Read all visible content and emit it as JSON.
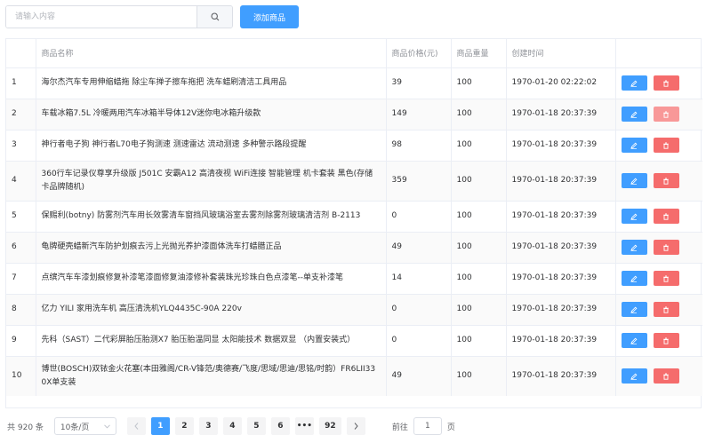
{
  "search": {
    "placeholder": "请输入内容",
    "value": ""
  },
  "toolbar": {
    "add_label": "添加商品"
  },
  "table": {
    "headers": [
      "",
      "商品名称",
      "商品价格(元)",
      "商品重量",
      "创建时间",
      ""
    ],
    "rows": [
      {
        "index": "1",
        "name": "海尔杰汽车专用伸缩蜡拖 除尘车掸子擦车拖把 洗车蜡刷清洁工具用品",
        "price": "39",
        "weight": "100",
        "created": "1970-01-20 02:22:02"
      },
      {
        "index": "2",
        "name": "车载冰箱7.5L 冷暖两用汽车冰箱半导体12V迷你电冰箱升级款",
        "price": "149",
        "weight": "100",
        "created": "1970-01-18 20:37:39"
      },
      {
        "index": "3",
        "name": "神行者电子狗 神行者L70电子狗测速 测速雷达 流动测速 多种警示路段提醒",
        "price": "98",
        "weight": "100",
        "created": "1970-01-18 20:37:39"
      },
      {
        "index": "4",
        "name": "360行车记录仪尊享升级版 J501C 安霸A12 高清夜视 WiFi连接 智能管理 机卡套装 黑色(存储卡品牌随机)",
        "price": "359",
        "weight": "100",
        "created": "1970-01-18 20:37:39"
      },
      {
        "index": "5",
        "name": "保赐利(botny) 防雾剂汽车用长效雾清车窗挡风玻璃浴室去雾剂除雾剂玻璃清洁剂 B-2113",
        "price": "0",
        "weight": "100",
        "created": "1970-01-18 20:37:39"
      },
      {
        "index": "6",
        "name": "龟牌硬壳蜡新汽车防护划痕去污上光抛光养护漆面体洗车打蜡腊正品",
        "price": "49",
        "weight": "100",
        "created": "1970-01-18 20:37:39"
      },
      {
        "index": "7",
        "name": "点缤汽车车漆划痕修复补漆笔漆面修复油漆修补套装珠光珍珠白色点漆笔--单支补漆笔",
        "price": "14",
        "weight": "100",
        "created": "1970-01-18 20:37:39"
      },
      {
        "index": "8",
        "name": "亿力 YILI 家用洗车机 高压清洗机YLQ4435C-90A 220v",
        "price": "0",
        "weight": "100",
        "created": "1970-01-18 20:37:39"
      },
      {
        "index": "9",
        "name": "先科（SAST）二代彩屏胎压胎测X7 胎压胎温同显 太阳能技术 数据双显 （内置安装式）",
        "price": "0",
        "weight": "100",
        "created": "1970-01-18 20:37:39"
      },
      {
        "index": "10",
        "name": "博世(BOSCH)双铱金火花塞(本田雅阁/CR-V锋范/奥德赛/飞度/思域/思迪/思铭/时韵）FR6LII330X单支装",
        "price": "49",
        "weight": "100",
        "created": "1970-01-18 20:37:39"
      }
    ]
  },
  "pagination": {
    "total": "共 920 条",
    "page_size": "10条/页",
    "pages": [
      "1",
      "2",
      "3",
      "4",
      "5",
      "6"
    ],
    "ellipsis": "•••",
    "last_page": "92",
    "current": "1",
    "goto_prefix": "前往",
    "goto_value": "1",
    "goto_suffix": "页"
  },
  "colors": {
    "primary": "#409eff",
    "danger": "#f56c6c",
    "border": "#ebeef5"
  },
  "icons": {
    "search": "search-icon",
    "edit": "edit-icon",
    "delete": "trash-icon"
  }
}
